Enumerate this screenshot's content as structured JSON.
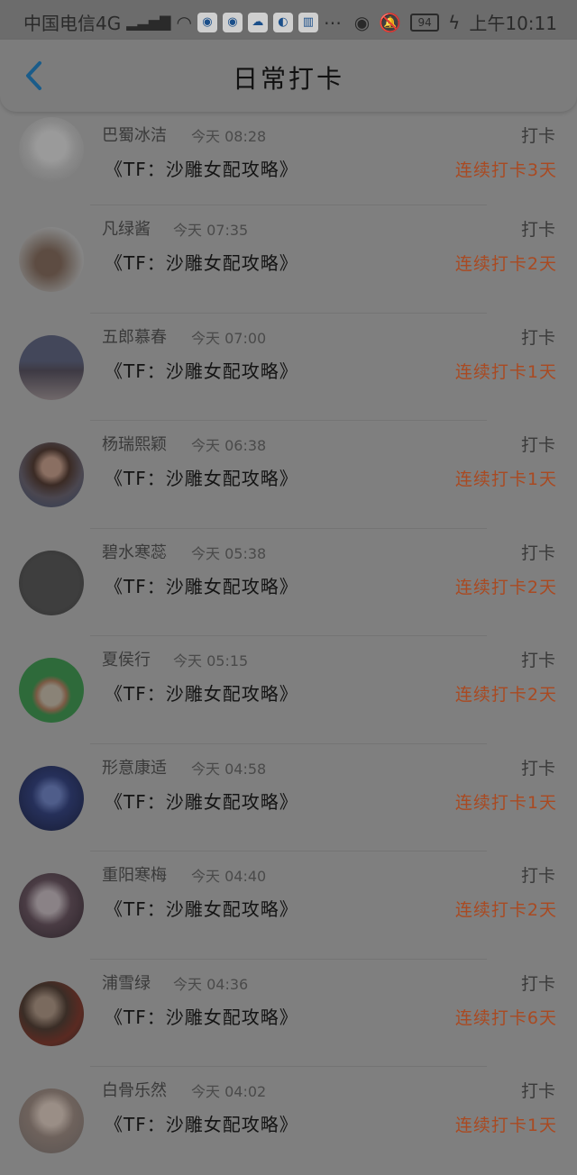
{
  "status": {
    "carrier": "中国电信4G",
    "network_badge": "4G",
    "battery": "94",
    "time": "上午10:11"
  },
  "header": {
    "title": "日常打卡"
  },
  "items": [
    {
      "name": "巴蜀冰洁",
      "time": "今天 08:28",
      "book": "《TF：沙雕女配攻略》",
      "action": "打卡",
      "streak": "连续打卡3天"
    },
    {
      "name": "凡绿酱",
      "time": "今天 07:35",
      "book": "《TF：沙雕女配攻略》",
      "action": "打卡",
      "streak": "连续打卡2天"
    },
    {
      "name": "五郎慕春",
      "time": "今天 07:00",
      "book": "《TF：沙雕女配攻略》",
      "action": "打卡",
      "streak": "连续打卡1天"
    },
    {
      "name": "杨瑞熙颖",
      "time": "今天 06:38",
      "book": "《TF：沙雕女配攻略》",
      "action": "打卡",
      "streak": "连续打卡1天"
    },
    {
      "name": "碧水寒蕊",
      "time": "今天 05:38",
      "book": "《TF：沙雕女配攻略》",
      "action": "打卡",
      "streak": "连续打卡2天"
    },
    {
      "name": "夏侯行",
      "time": "今天 05:15",
      "book": "《TF：沙雕女配攻略》",
      "action": "打卡",
      "streak": "连续打卡2天"
    },
    {
      "name": "形意康适",
      "time": "今天 04:58",
      "book": "《TF：沙雕女配攻略》",
      "action": "打卡",
      "streak": "连续打卡1天"
    },
    {
      "name": "重阳寒梅",
      "time": "今天 04:40",
      "book": "《TF：沙雕女配攻略》",
      "action": "打卡",
      "streak": "连续打卡2天"
    },
    {
      "name": "浦雪绿",
      "time": "今天 04:36",
      "book": "《TF：沙雕女配攻略》",
      "action": "打卡",
      "streak": "连续打卡6天"
    },
    {
      "name": "白骨乐然",
      "time": "今天 04:02",
      "book": "《TF：沙雕女配攻略》",
      "action": "打卡",
      "streak": "连续打卡1天"
    }
  ]
}
